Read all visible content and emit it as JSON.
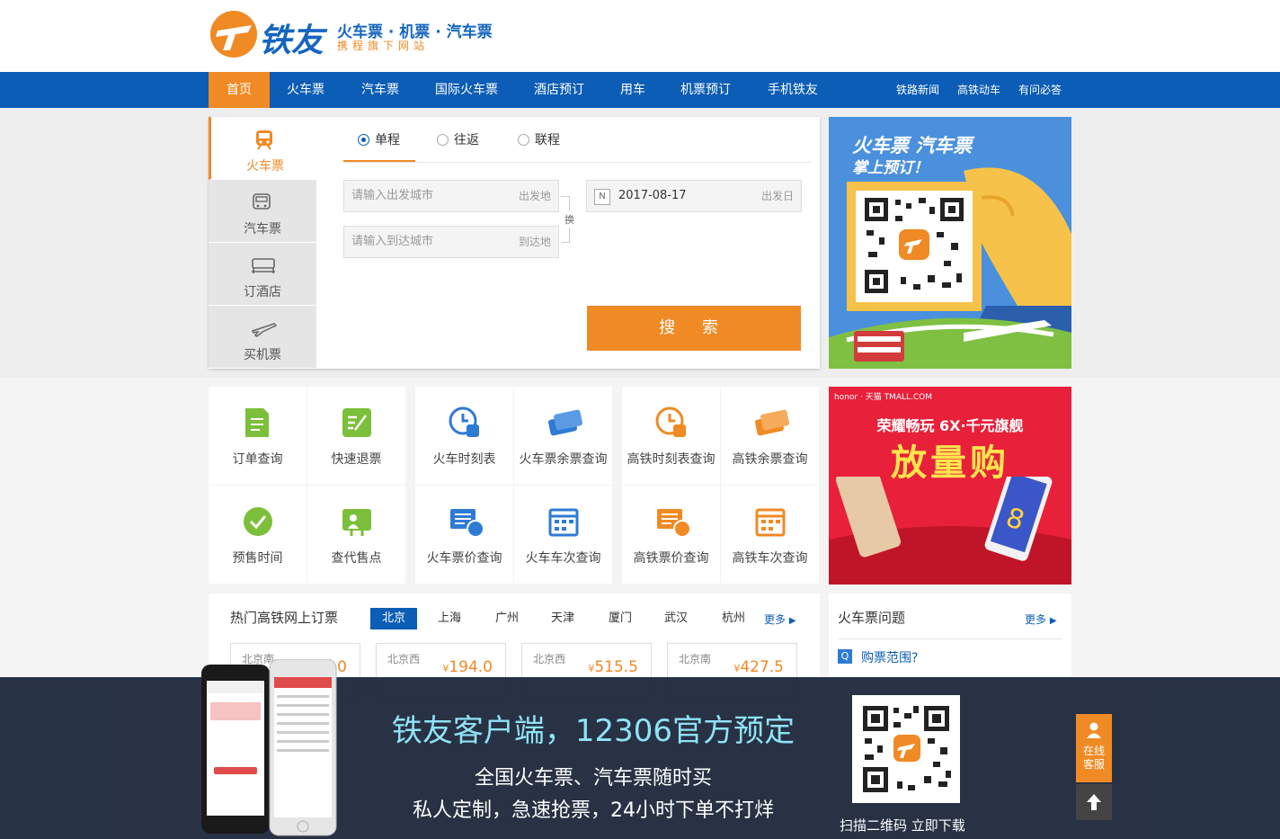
{
  "header": {
    "logo_name": "铁友",
    "logo_tagline": "火车票 · 机票 · 汽车票",
    "logo_sub": "携程旗下网站",
    "brand_color": "#f08a24",
    "nav_color": "#0c5db5"
  },
  "nav": {
    "items": [
      "首页",
      "火车票",
      "汽车票",
      "国际火车票",
      "酒店预订",
      "用车",
      "机票预订",
      "手机铁友"
    ],
    "right": [
      "铁路新闻",
      "高铁动车",
      "有问必答"
    ],
    "active": "首页"
  },
  "search": {
    "tabs": [
      "火车票",
      "汽车票",
      "订酒店",
      "买机票"
    ],
    "trip_types": [
      "单程",
      "往返",
      "联程"
    ],
    "selected_trip": "单程",
    "from_placeholder": "请输入出发城市",
    "from_tag": "出发地",
    "to_placeholder": "请输入到达城市",
    "to_tag": "到达地",
    "swap_label": "换",
    "date_value": "2017-08-17",
    "date_tag": "出发日",
    "date_icon_letter": "N",
    "button": "搜 索"
  },
  "qr_banner": {
    "line1": "火车票 汽车票",
    "line2": "掌上预订！"
  },
  "services": [
    {
      "label": "订单查询",
      "icon": "order-icon",
      "color": "#7cbf3a"
    },
    {
      "label": "快速退票",
      "icon": "refund-icon",
      "color": "#7cbf3a"
    },
    {
      "label": "火车时刻表",
      "icon": "train-clock-icon",
      "color": "#2e7bd4"
    },
    {
      "label": "火车票余票查询",
      "icon": "tickets-icon",
      "color": "#2e7bd4"
    },
    {
      "label": "高铁时刻表查询",
      "icon": "hsr-clock-icon",
      "color": "#f08a24"
    },
    {
      "label": "高铁余票查询",
      "icon": "hsr-tickets-icon",
      "color": "#f08a24"
    },
    {
      "label": "预售时间",
      "icon": "check-icon",
      "color": "#7cbf3a"
    },
    {
      "label": "查代售点",
      "icon": "agent-icon",
      "color": "#7cbf3a"
    },
    {
      "label": "火车票价查询",
      "icon": "price-icon",
      "color": "#2e7bd4"
    },
    {
      "label": "火车车次查询",
      "icon": "calendar-icon",
      "color": "#2e7bd4"
    },
    {
      "label": "高铁票价查询",
      "icon": "hsr-price-icon",
      "color": "#f08a24"
    },
    {
      "label": "高铁车次查询",
      "icon": "hsr-calendar-icon",
      "color": "#f08a24"
    }
  ],
  "honor_ad": {
    "brand": "honor · 天猫 TMALL.COM",
    "slogan": "荣耀畅玩 6X·千元旗舰",
    "big": "放量购"
  },
  "hot": {
    "title": "热门高铁网上订票",
    "cities": [
      "北京",
      "上海",
      "广州",
      "天津",
      "厦门",
      "武汉",
      "杭州"
    ],
    "active_city": "北京",
    "more": "更多",
    "cards": [
      {
        "from": "北京南",
        "price": "553.0"
      },
      {
        "from": "北京西",
        "price": "194.0"
      },
      {
        "from": "北京西",
        "price": "515.5"
      },
      {
        "from": "北京南",
        "price": "427.5"
      }
    ],
    "currency": "¥"
  },
  "faq": {
    "title": "火车票问题",
    "more": "更多",
    "q1": "购票范围?",
    "q_badge": "Q"
  },
  "app_banner": {
    "headline": "铁友客户端，12306官方预定",
    "line1": "全国火车票、汽车票随时买",
    "line2": "私人定制，急速抢票，24小时下单不打烊",
    "scan": "扫描二维码 立即下载"
  },
  "customer_service": {
    "label1": "在线",
    "label2": "客服"
  }
}
